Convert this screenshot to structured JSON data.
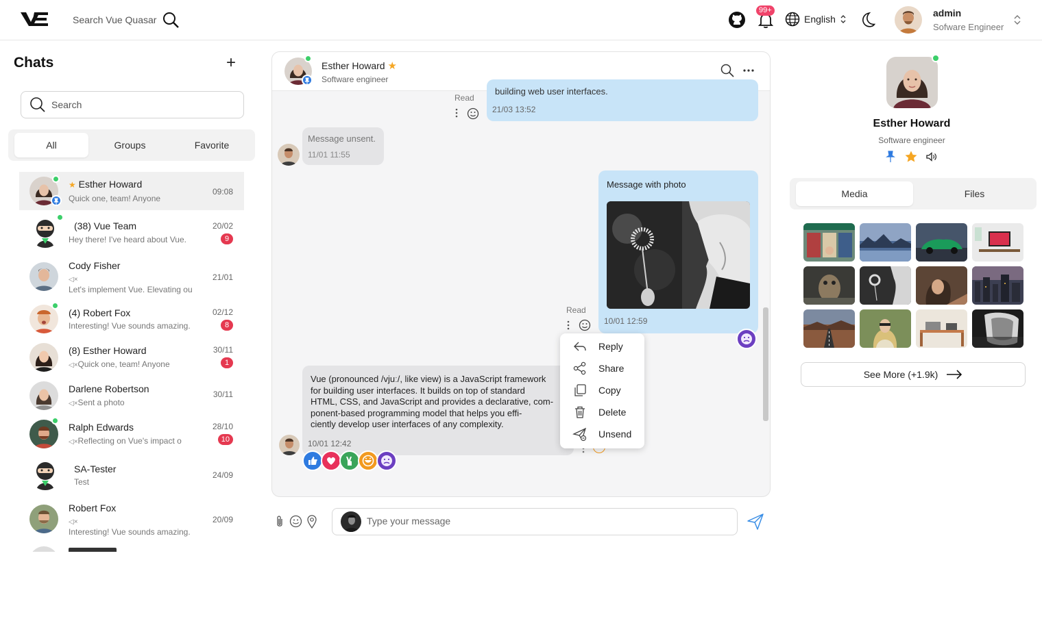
{
  "header": {
    "search_placeholder": "Search Vue Quasar",
    "notification_badge": "99+",
    "language": "English",
    "user_name": "admin",
    "user_role": "Sofware Engineer"
  },
  "sidebar": {
    "title": "Chats",
    "search_placeholder": "Search",
    "tabs": [
      "All",
      "Groups",
      "Favorite"
    ],
    "chats": [
      {
        "name": "Esther Howard",
        "preview": "Quick one, team! Anyone",
        "time": "09:08",
        "badge": "",
        "starred": true,
        "muted": false
      },
      {
        "name": "(38) Vue Team",
        "preview": "Hey there! I've heard about Vue.",
        "time": "20/02",
        "badge": "9",
        "starred": false,
        "muted": false
      },
      {
        "name": "Cody Fisher",
        "preview": "Let's implement Vue. Elevating ou",
        "time": "21/01",
        "badge": "",
        "starred": false,
        "muted": true
      },
      {
        "name": "(4) Robert Fox",
        "preview": "Interesting! Vue sounds amazing.",
        "time": "02/12",
        "badge": "8",
        "starred": false,
        "muted": false
      },
      {
        "name": "(8) Esther Howard",
        "preview": "Quick one, team! Anyone",
        "time": "30/11",
        "badge": "1",
        "starred": false,
        "muted": true
      },
      {
        "name": "Darlene Robertson",
        "preview": "Sent a photo",
        "time": "30/11",
        "badge": "",
        "starred": false,
        "muted": true
      },
      {
        "name": "Ralph Edwards",
        "preview": "Reflecting on Vue's impact o",
        "time": "28/10",
        "badge": "10",
        "starred": false,
        "muted": true
      },
      {
        "name": "SA-Tester",
        "preview": "Test",
        "time": "24/09",
        "badge": "",
        "starred": false,
        "muted": false
      },
      {
        "name": "Robert Fox",
        "preview": "Interesting! Vue sounds amazing.",
        "time": "20/09",
        "badge": "",
        "starred": false,
        "muted": true
      }
    ]
  },
  "chat": {
    "contact_name": "Esther Howard",
    "contact_role": "Software engineer",
    "messages": {
      "m1_text": "building web user interfaces.",
      "m1_time": "21/03 13:52",
      "read_label": "Read",
      "m2_text": "Message unsent.",
      "m2_time": "11/01 11:55",
      "m3_text": "Message with photo",
      "m3_time": "10/01 12:59",
      "m4_lines": [
        "Vue (pronounced /vjuː/, like view) is a JavaScript framework",
        "for building user interfaces. It builds on top of standard",
        "HTML, CSS, and JavaScript and provides a declarative, com-",
        "ponent-based programming model that helps you effi-",
        "ciently develop user interfaces of any complexity."
      ],
      "m4_time": "10/01 12:42"
    },
    "context_menu": [
      "Reply",
      "Share",
      "Copy",
      "Delete",
      "Unsend"
    ],
    "composer_placeholder": "Type your message"
  },
  "profile": {
    "name": "Esther Howard",
    "role": "Software engineer",
    "tabs": [
      "Media",
      "Files"
    ],
    "see_more": "See More (+1.9k)"
  },
  "colors": {
    "blue_bubble": "#c8e4f8",
    "grey_bubble": "#e4e4e6",
    "badge_red": "#e53950",
    "online_green": "#3ccf6a",
    "star": "#f5a623",
    "send_blue": "#3a8ee6"
  }
}
